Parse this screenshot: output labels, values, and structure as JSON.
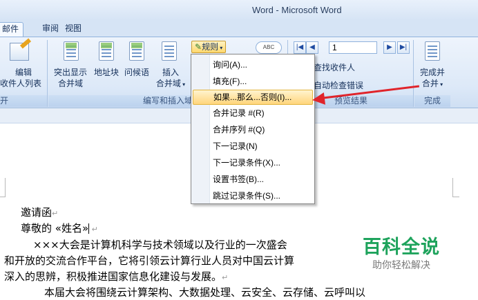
{
  "window": {
    "title": "Word - Microsoft Word"
  },
  "tabs": [
    {
      "label": "邮件",
      "active": true
    },
    {
      "label": "审阅",
      "active": false
    },
    {
      "label": "视图",
      "active": false
    }
  ],
  "ribbon": {
    "edit_recipients": {
      "line1": "编辑",
      "line2": "收件人列表"
    },
    "highlight_fields": {
      "line1": "突出显示",
      "line2": "合并域"
    },
    "address_block": "地址块",
    "greeting_line": "问候语",
    "insert_merge_field": {
      "line1": "插入",
      "line2": "合并域"
    },
    "rules_button": "规则",
    "record_number": "1",
    "find_recipient": "查找收件人",
    "auto_check_errors": "自动检查错误",
    "finish_merge": {
      "line1": "完成并",
      "line2": "合并"
    },
    "groups": {
      "start": "开",
      "write_insert": "编写和插入域",
      "preview": "预览结果",
      "finish": "完成"
    }
  },
  "rules_menu": {
    "items": [
      {
        "label": "询问(A)...",
        "highlighted": false
      },
      {
        "label": "填充(F)...",
        "highlighted": false
      },
      {
        "label": "如果...那么...否则(I)...",
        "highlighted": true
      },
      {
        "label": "合并记录 #(R)",
        "highlighted": false
      },
      {
        "label": "合并序列 #(Q)",
        "highlighted": false
      },
      {
        "label": "下一记录(N)",
        "highlighted": false
      },
      {
        "label": "下一记录条件(X)...",
        "highlighted": false
      },
      {
        "label": "设置书签(B)...",
        "highlighted": false
      },
      {
        "label": "跳过记录条件(S)...",
        "highlighted": false
      }
    ]
  },
  "document": {
    "lines": [
      "邀请函",
      "尊敬的 «姓名»",
      "×××大会是计算机科学与技术领域以及行业的一次盛会",
      "和开放的交流合作平台，它将引领云计算行业人员对中国云计算",
      "深入的思辨，积极推进国家信息化建设与发展。",
      "本届大会将围绕云计算架构、大数据处理、云安全、云存储、云呼叫以"
    ]
  },
  "watermark": {
    "main": "百科全说",
    "sub": "助你轻松解决"
  },
  "colors": {
    "highlight": "#ffd57c",
    "arrow": "#e0242b",
    "watermark": "#1ea35c",
    "ribbon": "#dde9f8"
  }
}
